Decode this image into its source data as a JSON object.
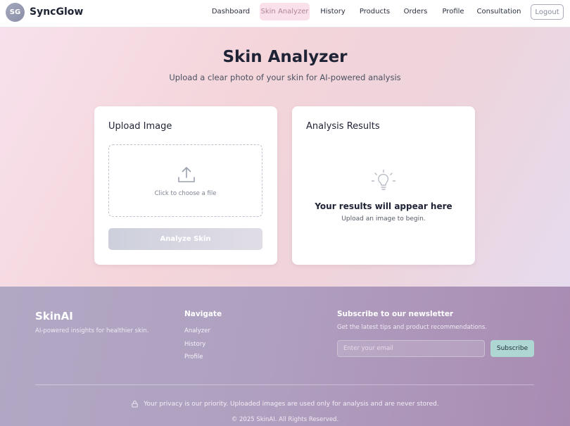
{
  "header": {
    "avatar_initials": "SG",
    "brand": "SyncGlow",
    "nav": [
      {
        "label": "Dashboard",
        "active": false
      },
      {
        "label": "Skin Analyzer",
        "active": true
      },
      {
        "label": "History",
        "active": false
      },
      {
        "label": "Products",
        "active": false
      },
      {
        "label": "Orders",
        "active": false
      },
      {
        "label": "Profile",
        "active": false
      },
      {
        "label": "Consultation",
        "active": false
      }
    ],
    "logout_label": "Logout"
  },
  "hero": {
    "title": "Skin Analyzer",
    "subtitle": "Upload a clear photo of your skin for AI-powered analysis"
  },
  "upload_card": {
    "title": "Upload Image",
    "dropzone_text": "Click to choose a file",
    "upload_icon": "upload-icon",
    "analyze_label": "Analyze Skin"
  },
  "results_card": {
    "title": "Analysis Results",
    "icon": "lightbulb-icon",
    "heading": "Your results will appear here",
    "subtext": "Upload an image to begin."
  },
  "footer": {
    "brand": "SkinAI",
    "tagline": "AI-powered insights for healthier skin.",
    "navigate_heading": "Navigate",
    "links": [
      "Analyzer",
      "History",
      "Profile"
    ],
    "newsletter_heading": "Subscribe to our newsletter",
    "newsletter_sub": "Get the latest tips and product recommendations.",
    "email_placeholder": "Enter your email",
    "subscribe_label": "Subscribe",
    "privacy_text": "Your privacy is our priority. Uploaded images are used only for analysis and are never stored.",
    "copyright": "© 2025 SkinAI. All Rights Reserved."
  },
  "colors": {
    "active_nav_bg": "#f9e0ea",
    "subscribe_bg": "#aed7d3",
    "brand_dark": "#1e2333"
  }
}
